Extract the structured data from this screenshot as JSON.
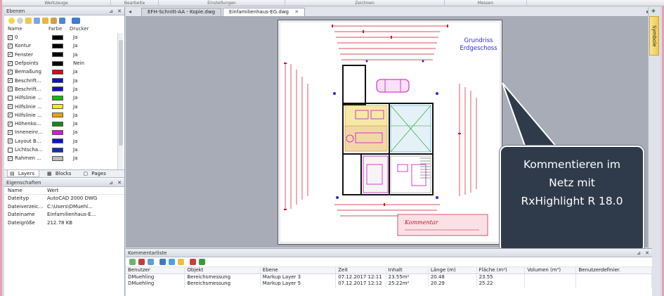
{
  "ribbon": {
    "groups": [
      "Werkzeuge",
      "Bearbeite",
      "Einstellungen",
      "Zeichnen",
      "Messen"
    ]
  },
  "layers_panel": {
    "title": "Ebenen",
    "columns": [
      "Name",
      "Farbe",
      "Drucker"
    ],
    "items": [
      {
        "checked": true,
        "name": "0",
        "color": "#000000",
        "print": "Ja"
      },
      {
        "checked": true,
        "name": "Kontur",
        "color": "#000000",
        "print": "Ja"
      },
      {
        "checked": true,
        "name": "Fenster",
        "color": "#000000",
        "print": "Ja"
      },
      {
        "checked": true,
        "name": "Defpoints",
        "color": "#000000",
        "print": "Nein"
      },
      {
        "checked": true,
        "name": "Bemaßung",
        "color": "#e0001a",
        "print": "Ja"
      },
      {
        "checked": true,
        "name": "Beschrift...",
        "color": "#1010d0",
        "print": "Ja"
      },
      {
        "checked": true,
        "name": "Beschrift...",
        "color": "#1010d0",
        "print": "Ja"
      },
      {
        "checked": false,
        "name": "Hilfslinie ...",
        "color": "#00c000",
        "print": "Ja"
      },
      {
        "checked": true,
        "name": "Hilfslinie ...",
        "color": "#f0f000",
        "print": "Ja"
      },
      {
        "checked": true,
        "name": "Hilfslinie ...",
        "color": "#f0a000",
        "print": "Ja"
      },
      {
        "checked": true,
        "name": "Höhenko...",
        "color": "#1a8a1a",
        "print": "Ja"
      },
      {
        "checked": true,
        "name": "Inneneinr...",
        "color": "#e010e0",
        "print": "Ja"
      },
      {
        "checked": true,
        "name": "Layout B...",
        "color": "#1010d0",
        "print": "Ja"
      },
      {
        "checked": false,
        "name": "Lichtscha...",
        "color": "#1030b0",
        "print": "Ja"
      },
      {
        "checked": true,
        "name": "Rahmen ...",
        "color": "#bdbdbd",
        "print": "Ja"
      }
    ],
    "tabs": [
      "Layers",
      "Blocks",
      "Pages"
    ]
  },
  "properties_panel": {
    "title": "Eigenschaften",
    "columns": [
      "Name",
      "Wert"
    ],
    "rows": [
      {
        "name": "Dateityp",
        "value": "AutoCAD 2000 DWG"
      },
      {
        "name": "Dateiverzeic...",
        "value": "C:\\Users\\DMuehl..."
      },
      {
        "name": "Dateiname",
        "value": "Einfamilienhaus-E..."
      },
      {
        "name": "Dateigröße",
        "value": "212.78 KB"
      }
    ]
  },
  "document_tabs": [
    {
      "label": "EFH-Schnitt-AA - Kopie.dwg",
      "active": false
    },
    {
      "label": "Einfamilienhaus-EG.dwg",
      "active": true
    }
  ],
  "drawing": {
    "title_line1": "Grundriss",
    "title_line2": "Erdgeschoss",
    "title_color": "#2b2bd6",
    "stamp_text": "Kommentar"
  },
  "callout": {
    "line1": "Kommentieren im",
    "line2": "Netz mit",
    "line3": "RxHighlight R 18.0",
    "bg_color": "#2f3b4b"
  },
  "right_sidebar": {
    "tab_label": "Symbole"
  },
  "comments": {
    "title": "Kommentarliste",
    "columns": [
      "Benutzer",
      "Objekt",
      "Ebene",
      "Zeit",
      "Inhalt",
      "Länge (m)",
      "Fläche (m²)",
      "Volumen (m³)",
      "Benutzerdefinier."
    ],
    "rows": [
      [
        "DMuehling",
        "Bereichsmessung",
        "Markup Layer 3",
        "07.12.2017 12:11",
        "23.55m²",
        "20.48",
        "23.55",
        "",
        ""
      ],
      [
        "DMuehling",
        "Bereichsmessung",
        "Markup Layer 5",
        "07.12.2017 12:12",
        "25.22m²",
        "20.29",
        "25.22",
        "",
        ""
      ]
    ]
  }
}
